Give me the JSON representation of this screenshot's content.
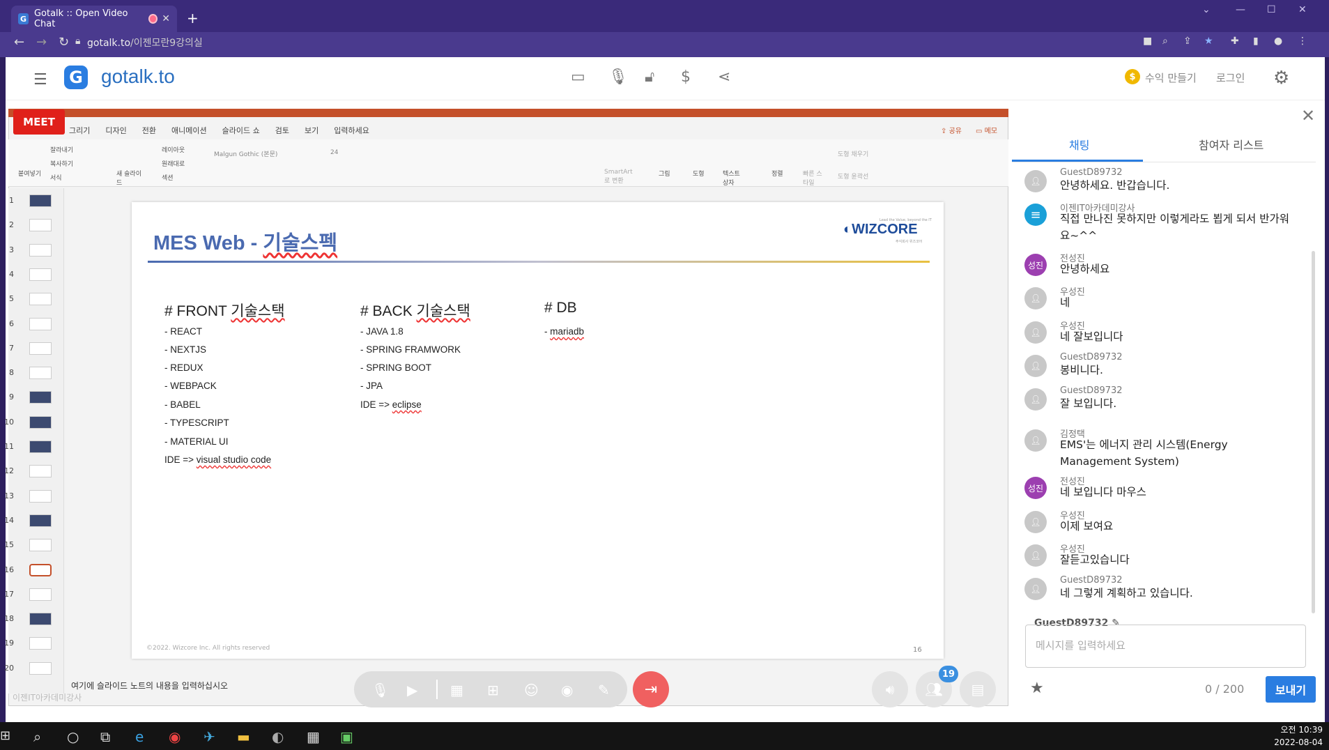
{
  "browser": {
    "tab_title": "Gotalk :: Open Video Chat",
    "url_domain": "gotalk.to",
    "url_path": "/이젠모란9강의실"
  },
  "app": {
    "logo_letter": "G",
    "logo_text": "gotalk.to",
    "earn_label": "수익 만들기",
    "login_label": "로그인"
  },
  "powerpoint": {
    "meet_badge": "MEET",
    "menu_tabs": [
      "그리기",
      "디자인",
      "전환",
      "애니메이션",
      "슬라이드 쇼",
      "검토",
      "보기",
      "입력하세요"
    ],
    "share_label": "공유",
    "memo_label": "메모",
    "ribbon": {
      "paste": "붙여넣기",
      "cut": "잘라내기",
      "copy": "복사하기",
      "format": "서식",
      "new_slide": "새 슬라이드",
      "layout": "레이아웃",
      "reset": "원래대로",
      "section": "섹션",
      "font": "Malgun Gothic (본문)",
      "size": "24",
      "smartart": "SmartArt로 변환",
      "picture": "그림",
      "shape": "도형",
      "textbox": "텍스트 상자",
      "arrange": "정렬",
      "quickstyle": "빠른 스타일",
      "fill": "도형 채우기",
      "outline": "도형 윤곽선"
    },
    "thumbnails": [
      "1",
      "2",
      "3",
      "4",
      "5",
      "6",
      "7",
      "8",
      "9",
      "10",
      "11",
      "12",
      "13",
      "14",
      "15",
      "16",
      "17",
      "18",
      "19",
      "20"
    ],
    "notes_placeholder": "여기에 슬라이드 노트의 내용을 입력하십시오",
    "watermark": "이젠IT아카데미강사"
  },
  "slide": {
    "title_en": "MES Web - ",
    "title_ko": "기술스펙",
    "brand": "WIZCORE",
    "brand_tagline": "Lead the Value, beyond the IT",
    "brand_sub": "주식회사 위즈코어",
    "front": {
      "heading_prefix": "# FRONT ",
      "heading_ko": "기술스택",
      "items": [
        "- REACT",
        "- NEXTJS",
        "- REDUX",
        "- WEBPACK",
        "- BABEL",
        "- TYPESCRIPT",
        "- MATERIAL UI"
      ],
      "ide_prefix": "IDE => ",
      "ide_value": "visual studio code"
    },
    "back": {
      "heading_prefix": "# BACK ",
      "heading_ko": "기술스택",
      "items": [
        "- JAVA 1.8",
        "- SPRING FRAMWORK",
        "- SPRING BOOT",
        "- JPA"
      ],
      "ide_prefix": "IDE => ",
      "ide_value": "eclipse"
    },
    "db": {
      "heading": "# DB",
      "item_prefix": "- ",
      "item_value": "mariadb"
    },
    "footer_left": "©2022. Wizcore Inc. All rights reserved",
    "page_number": "16"
  },
  "controls": {
    "participant_count": "19"
  },
  "chat": {
    "tab_chat": "채팅",
    "tab_participants": "참여자 리스트",
    "messages": [
      {
        "name": "GuestD89732",
        "text": "안녕하세요. 반갑습니다.",
        "avatar": "default"
      },
      {
        "name": "이젠IT아카데미강사",
        "text": "직접 만나진 못하지만 이렇게라도 뵙게 되서 반가워요~^^",
        "avatar": "brand"
      },
      {
        "name": "전성진",
        "text": "안녕하세요",
        "avatar": "성진"
      },
      {
        "name": "우성진",
        "text": "네",
        "avatar": "default"
      },
      {
        "name": "우성진",
        "text": "네 잘보입니다",
        "avatar": "default"
      },
      {
        "name": "GuestD89732",
        "text": "봉비니다.",
        "avatar": "default"
      },
      {
        "name": "GuestD89732",
        "text": "잘 보입니다.",
        "avatar": "default"
      },
      {
        "name": "김정택",
        "text": "EMS'는 에너지 관리 시스템(Energy Management System)",
        "avatar": "default"
      },
      {
        "name": "전성진",
        "text": "네 보입니다 마우스",
        "avatar": "성진"
      },
      {
        "name": "우성진",
        "text": "이제 보여요",
        "avatar": "default"
      },
      {
        "name": "우성진",
        "text": "잘듣고있습니다",
        "avatar": "default"
      },
      {
        "name": "GuestD89732",
        "text": "네 그렇게 계획하고 있습니다.",
        "avatar": "default"
      }
    ],
    "my_name": "GuestD89732",
    "input_placeholder": "메시지를 입력하세요",
    "char_count": "0 / 200",
    "send_label": "보내기"
  },
  "taskbar": {
    "time": "오전 10:39",
    "date": "2022-08-04"
  },
  "colors": {
    "browser_frame": "#3a2a7a",
    "accent_blue": "#2a7de1",
    "leave_red": "#f06060",
    "ppt_orange": "#c4502a",
    "avatar_purple": "#9c3fb0"
  }
}
